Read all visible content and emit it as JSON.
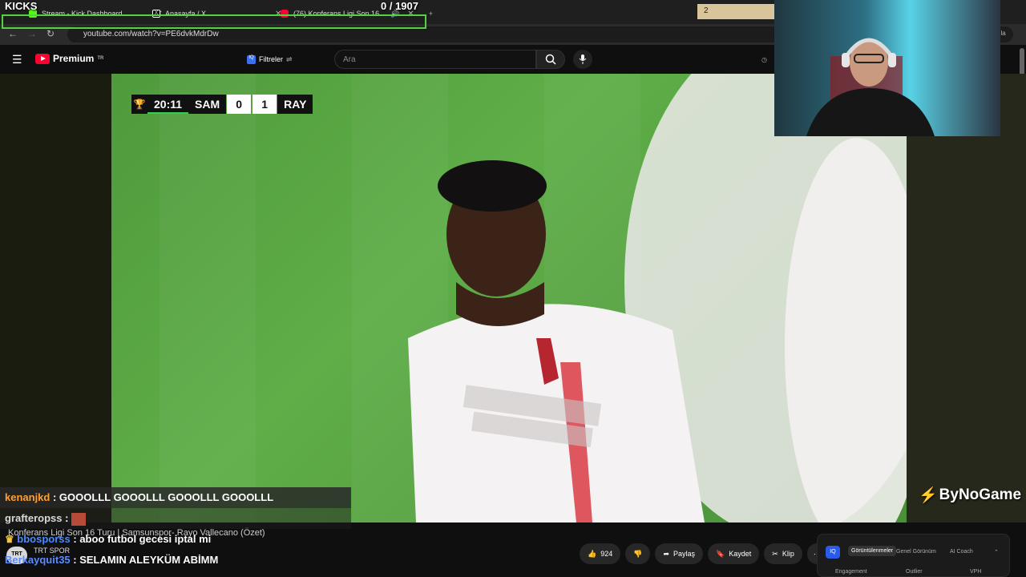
{
  "overlay": {
    "kicks_label": "KICKS",
    "kicks_count": "0 / 1907",
    "donation_value": "2"
  },
  "browser": {
    "tabs": [
      {
        "label": "Stream - Kick Dashboard",
        "color": "#53fc18"
      },
      {
        "label": "Anasayfa / X",
        "color": "#ffffff"
      },
      {
        "label": "(76) Konferans Ligi Son 16",
        "color": "#ff0033"
      }
    ],
    "url": "youtube.com/watch?v=PE6dvkMdrDw",
    "side_label": "nla"
  },
  "youtube": {
    "brand": "Premium",
    "region": "TR",
    "filters_label": "Filtreler",
    "search_placeholder": "Ara"
  },
  "scoreboard": {
    "time": "20:11",
    "home": "SAM",
    "home_goals": "0",
    "away_goals": "1",
    "away": "RAY"
  },
  "watermark": "ByNoGame",
  "chat": [
    {
      "user": "kenanjkd",
      "text": "GOOOLLL GOOOLLL GOOOLLL GOOOLLL"
    },
    {
      "user": "grafteropss",
      "text": ""
    },
    {
      "user": "bbosporss",
      "text": "aboo futbol gecesi iptal mi"
    },
    {
      "user": "Berkayquit35",
      "text": "SELAMIN ALEYKÜM ABİMM"
    }
  ],
  "video": {
    "title": "Konferans Ligi Son 16 Turu | Samsunspor- Rayo Vallecano (Özet)",
    "channel": "TRT SPOR",
    "likes": "924",
    "share_label": "Paylaş",
    "save_label": "Kaydet",
    "clip_label": "Klip"
  },
  "panel": {
    "tabs": [
      "Görüntülenmeler",
      "Genel Görünüm",
      "AI Coach"
    ],
    "bottom": [
      "Engagement",
      "Outlier",
      "VPH"
    ]
  }
}
